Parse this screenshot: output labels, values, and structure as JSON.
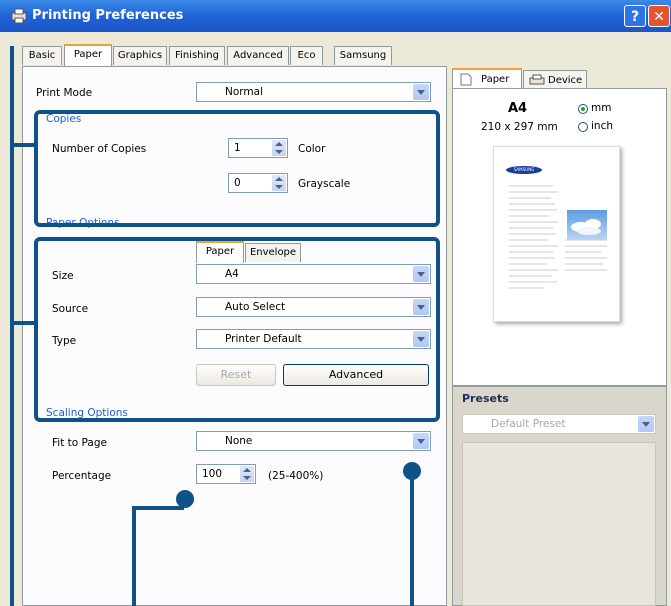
{
  "window": {
    "title": "Printing Preferences",
    "help_label": "?",
    "close_label": "✕"
  },
  "tabs": [
    {
      "label": "Basic"
    },
    {
      "label": "Paper",
      "active": true
    },
    {
      "label": "Graphics"
    },
    {
      "label": "Finishing"
    },
    {
      "label": "Advanced"
    },
    {
      "label": "Eco"
    },
    {
      "label": "Samsung"
    }
  ],
  "print_mode": {
    "label": "Print Mode",
    "value": "Normal"
  },
  "copies": {
    "legend": "Copies",
    "number_label": "Number of Copies",
    "color_value": "1",
    "color_label": "Color",
    "grayscale_value": "0",
    "grayscale_label": "Grayscale"
  },
  "paper_options": {
    "legend": "Paper Options",
    "subtabs": [
      "Paper",
      "Envelope"
    ],
    "size_label": "Size",
    "size_value": "A4",
    "source_label": "Source",
    "source_value": "Auto Select",
    "type_label": "Type",
    "type_value": "Printer Default",
    "reset_label": "Reset",
    "advanced_label": "Advanced"
  },
  "scaling": {
    "legend": "Scaling Options",
    "fit_label": "Fit to Page",
    "fit_value": "None",
    "percentage_label": "Percentage",
    "percentage_value": "100",
    "range_label": "(25-400%)"
  },
  "preview": {
    "tabs": [
      "Paper",
      "Device"
    ],
    "paper_size": "A4",
    "dimensions": "210 x 297 mm",
    "unit_mm": "mm",
    "unit_inch": "inch",
    "selected_unit": "mm",
    "logo_text": "SAMSUNG"
  },
  "presets": {
    "title": "Presets",
    "value": "Default Preset"
  },
  "colors": {
    "accent": "#0f5289",
    "title_bar": "#1f63d8",
    "legend": "#1f5fcf"
  }
}
